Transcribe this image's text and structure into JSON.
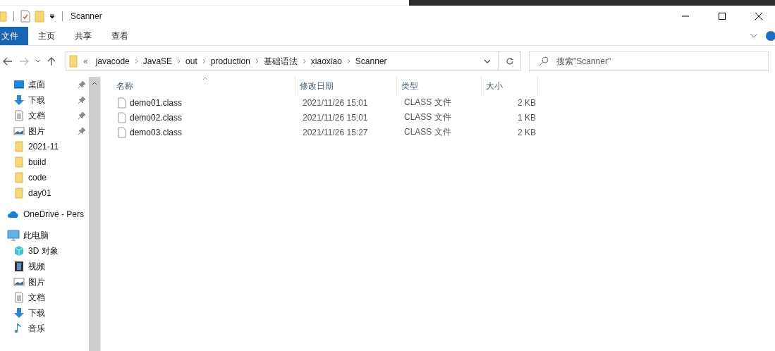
{
  "window": {
    "title": "Scanner"
  },
  "ribbon_tabs": [
    {
      "label": "文件",
      "selected": true
    },
    {
      "label": "主页",
      "selected": false
    },
    {
      "label": "共享",
      "selected": false
    },
    {
      "label": "查看",
      "selected": false
    }
  ],
  "address": {
    "overflow": "«",
    "segments": [
      "javacode",
      "JavaSE",
      "out",
      "production",
      "基础语法",
      "xiaoxiao",
      "Scanner"
    ]
  },
  "search": {
    "placeholder": "搜索\"Scanner\""
  },
  "sidebar": {
    "quick_access": [
      {
        "label": "桌面",
        "kind": "desktop",
        "pinned": true
      },
      {
        "label": "下载",
        "kind": "download",
        "pinned": true
      },
      {
        "label": "文档",
        "kind": "document",
        "pinned": true
      },
      {
        "label": "图片",
        "kind": "picture",
        "pinned": true
      },
      {
        "label": "2021-11",
        "kind": "folder",
        "pinned": false
      },
      {
        "label": "build",
        "kind": "folder",
        "pinned": false
      },
      {
        "label": "code",
        "kind": "folder",
        "pinned": false
      },
      {
        "label": "day01",
        "kind": "folder",
        "pinned": false
      }
    ],
    "onedrive": {
      "label": "OneDrive - Pers",
      "kind": "cloud"
    },
    "this_pc": {
      "label": "此电脑",
      "kind": "pc",
      "children": [
        {
          "label": "3D 对象",
          "kind": "cube"
        },
        {
          "label": "视频",
          "kind": "video"
        },
        {
          "label": "图片",
          "kind": "picture"
        },
        {
          "label": "文档",
          "kind": "document"
        },
        {
          "label": "下载",
          "kind": "download"
        },
        {
          "label": "音乐",
          "kind": "music"
        }
      ]
    }
  },
  "table": {
    "columns": [
      "名称",
      "修改日期",
      "类型",
      "大小"
    ],
    "rows": [
      {
        "name": "demo01.class",
        "modified": "2021/11/26 15:01",
        "type": "CLASS 文件",
        "size": "2 KB"
      },
      {
        "name": "demo02.class",
        "modified": "2021/11/26 15:01",
        "type": "CLASS 文件",
        "size": "1 KB"
      },
      {
        "name": "demo03.class",
        "modified": "2021/11/26 15:27",
        "type": "CLASS 文件",
        "size": "2 KB"
      }
    ]
  }
}
